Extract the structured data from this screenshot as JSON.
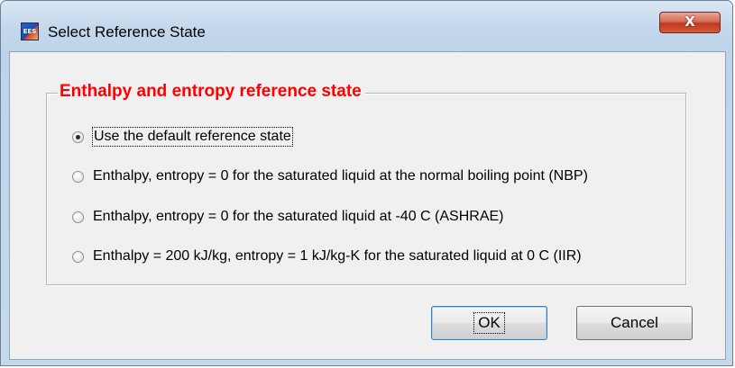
{
  "window": {
    "title": "Select Reference State",
    "close_glyph": "X",
    "app_icon_glyph": "EES"
  },
  "group": {
    "title": "Enthalpy and entropy reference state",
    "options": [
      {
        "label": "Use the default reference state",
        "checked": true
      },
      {
        "label": "Enthalpy, entropy = 0 for the saturated liquid at the normal boiling point (NBP)",
        "checked": false
      },
      {
        "label": "Enthalpy, entropy = 0 for the saturated liquid at -40 C (ASHRAE)",
        "checked": false
      },
      {
        "label": "Enthalpy = 200 kJ/kg, entropy = 1 kJ/kg-K for the saturated liquid at 0 C (IIR)",
        "checked": false
      }
    ]
  },
  "buttons": {
    "ok_label": "OK",
    "cancel_label": "Cancel"
  },
  "colors": {
    "group_title": "#ff0000",
    "dialog_bg": "#f0f0f0",
    "close_button": "#c0391f"
  }
}
